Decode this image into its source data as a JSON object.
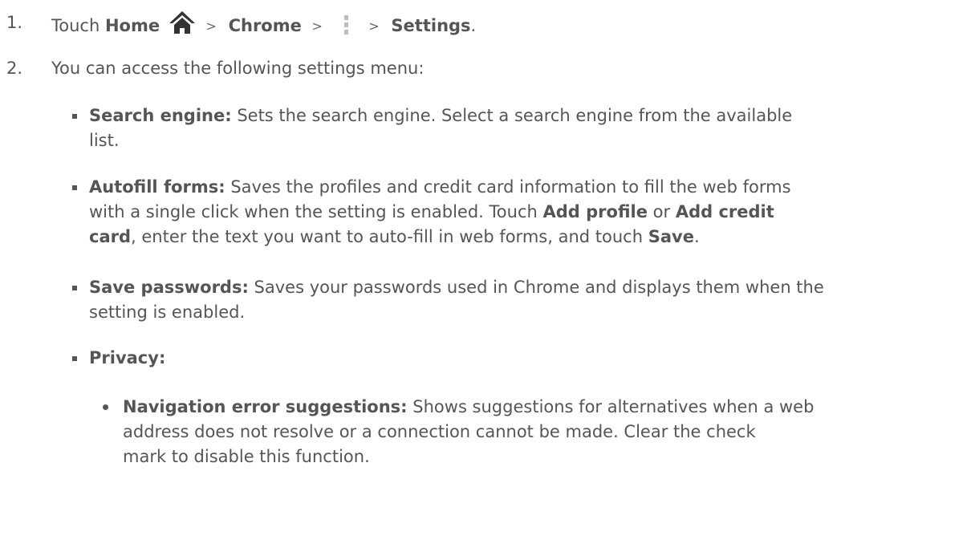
{
  "steps": [
    {
      "num": "1.",
      "touch": "Touch",
      "home": "Home",
      "sep1": ">",
      "chrome": "Chrome",
      "sep2": ">",
      "sep3": ">",
      "settings": "Settings",
      "end": "."
    },
    {
      "num": "2.",
      "text": "You can access the following settings menu:"
    }
  ],
  "items": [
    {
      "title": "Search engine:",
      "desc_lines": [
        "Sets the search engine. Select a search engine from the available",
        "list."
      ]
    },
    {
      "title": "Autofill forms:",
      "line1": "Saves the profiles and credit card information to fill the web forms",
      "line2_pre": "with a single click when the setting is enabled. Touch",
      "add_profile": "Add profile",
      "or": "or",
      "add_credit": "Add credit",
      "card": "card",
      "line3_mid": ", enter the text you want to auto-fill in web forms, and touch",
      "save": "Save",
      "end": "."
    },
    {
      "title": "Save passwords:",
      "desc_lines": [
        "Saves your passwords used in Chrome and displays them when the",
        "setting is enabled."
      ]
    },
    {
      "title": "Privacy:"
    }
  ],
  "sub_items": [
    {
      "title": "Navigation error suggestions:",
      "line1": "Shows suggestions for alternatives when a web",
      "line2": "address does not resolve or a connection cannot be made. Clear the check",
      "line3": "mark to disable this function."
    }
  ],
  "icons": {
    "home": "home-icon",
    "menu": "overflow-menu-icon"
  },
  "colors": {
    "text": "#555555"
  }
}
